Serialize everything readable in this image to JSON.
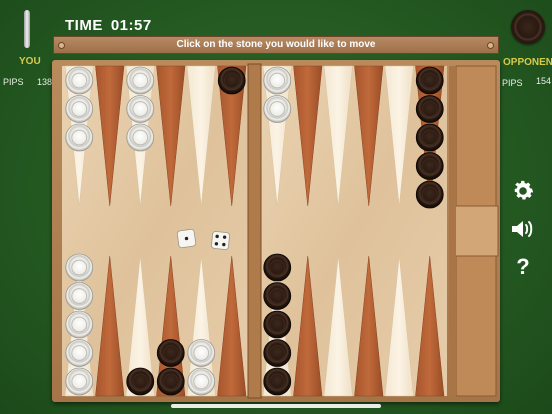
{
  "player": {
    "label": "YOU",
    "pips_label": "PIPS",
    "pips": "138"
  },
  "opponent": {
    "label": "OPPONENT",
    "pips_label": "PIPS",
    "pips": "154"
  },
  "timer": {
    "label": "TIME",
    "value": "01:57"
  },
  "message": "Click on the stone you would like to move",
  "icons": {
    "settings": "gear-icon",
    "sound": "speaker-icon",
    "help": "question-icon"
  },
  "colors": {
    "felt": "#255a22",
    "you_label": "#d9c94a",
    "light_stone": "#ecebe6",
    "dark_stone": "#2a1a12"
  },
  "dice": [
    1,
    4
  ],
  "points": [
    {
      "point": 1,
      "color": "light",
      "count": 3
    },
    {
      "point": 3,
      "color": "light",
      "count": 3
    },
    {
      "point": 6,
      "color": "dark",
      "count": 1
    },
    {
      "point": 7,
      "color": "light",
      "count": 2
    },
    {
      "point": 12,
      "color": "dark",
      "count": 5
    },
    {
      "point": 13,
      "color": "light",
      "count": 5
    },
    {
      "point": 15,
      "color": "dark",
      "count": 1
    },
    {
      "point": 16,
      "color": "dark",
      "count": 2
    },
    {
      "point": 17,
      "color": "light",
      "count": 2
    },
    {
      "point": 19,
      "color": "dark",
      "count": 5
    }
  ]
}
